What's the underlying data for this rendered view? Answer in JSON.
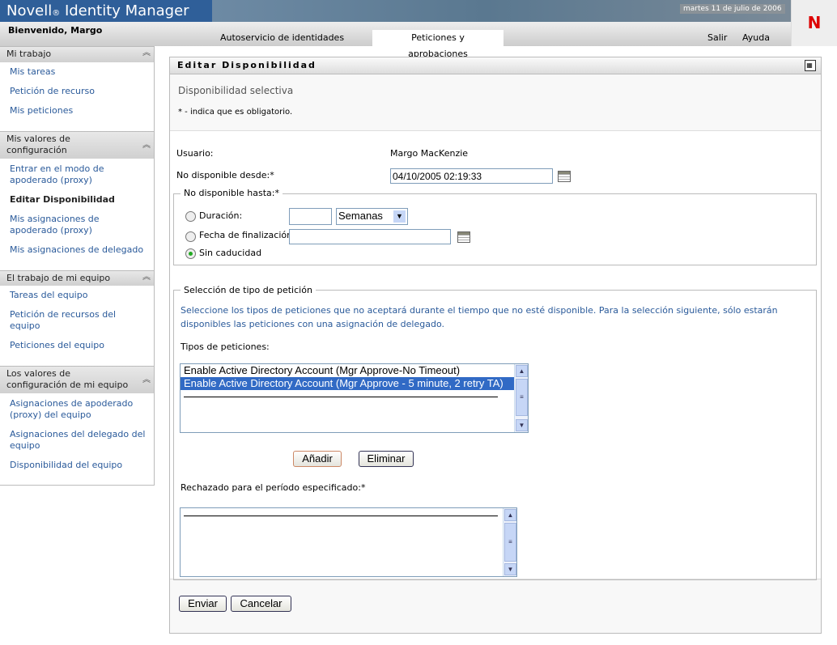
{
  "header": {
    "app_title": "Novell",
    "app_title_reg": "®",
    "app_title_rest": " Identity Manager",
    "date": "martes 11 de julio de 2006",
    "logo": "N",
    "welcome": "Bienvenido, Margo",
    "tabs": [
      "Autoservicio de identidades",
      "Peticiones y aprobaciones"
    ],
    "links": {
      "logout": "Salir",
      "help": "Ayuda"
    }
  },
  "sidebar": {
    "sections": [
      {
        "title": "Mi trabajo",
        "items": [
          "Mis tareas",
          "Petición de recurso",
          "Mis peticiones"
        ]
      },
      {
        "title": "Mis valores de configuración",
        "items": [
          "Entrar en el modo de apoderado (proxy)",
          "Editar Disponibilidad",
          "Mis asignaciones de apoderado (proxy)",
          "Mis asignaciones de delegado"
        ]
      },
      {
        "title": "El trabajo de mi equipo",
        "items": [
          "Tareas del equipo",
          "Petición de recursos del equipo",
          "Peticiones del equipo"
        ]
      },
      {
        "title": "Los valores de configuración de mi equipo",
        "items": [
          "Asignaciones de apoderado (proxy) del equipo",
          "Asignaciones del delegado del equipo",
          "Disponibilidad del equipo"
        ]
      }
    ]
  },
  "panel": {
    "title": "Editar Disponibilidad",
    "subtitle": "Disponibilidad selectiva",
    "required_note": "* - indica que es obligatorio.",
    "user_label": "Usuario:",
    "user_value": "Margo MacKenzie",
    "from_label": "No disponible desde:*",
    "from_value": "04/10/2005 02:19:33",
    "until_legend": "No disponible hasta:*",
    "duration_label": "Duración:",
    "duration_value": "",
    "duration_unit": "Semanas",
    "enddate_label": "Fecha de finalización:",
    "enddate_value": "",
    "noexpiry_label": "Sin caducidad",
    "selected_option": "Sin caducidad",
    "type_legend": "Selección de tipo de petición",
    "type_help": "Seleccione los tipos de peticiones que no aceptará durante el tiempo que no esté disponible. Para la selección siguiente, sólo estarán disponibles las peticiones con una asignación de delegado.",
    "types_label": "Tipos de peticiones:",
    "types": [
      "Enable Active Directory Account (Mgr Approve-No Timeout)",
      "Enable Active Directory Account (Mgr Approve - 5 minute, 2 retry TA)"
    ],
    "add": "Añadir",
    "remove": "Eliminar",
    "rejected_label": "Rechazado para el período especificado:*",
    "submit": "Enviar",
    "cancel": "Cancelar"
  }
}
